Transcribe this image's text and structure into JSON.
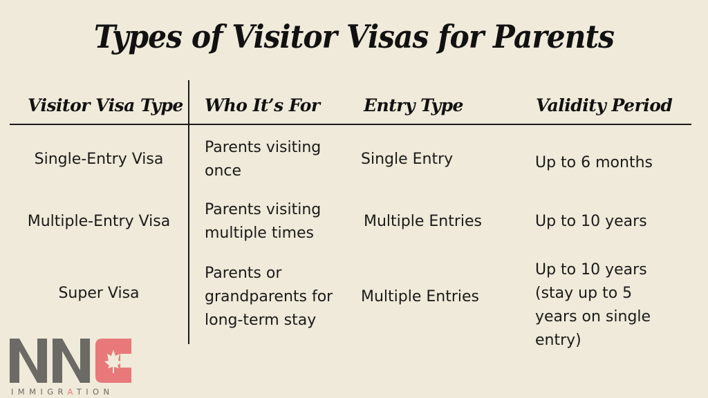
{
  "title": "Types of Visitor Visas for Parents",
  "table": {
    "headers": [
      "Visitor Visa Type",
      "Who It’s For",
      "Entry Type",
      "Validity Period"
    ],
    "rows": [
      {
        "type": "Single-Entry Visa",
        "who": [
          "Parents visiting",
          "once"
        ],
        "entry": "Single Entry",
        "validity": [
          "Up to 6 months"
        ]
      },
      {
        "type": "Multiple-Entry Visa",
        "who": [
          "Parents visiting",
          "multiple times"
        ],
        "entry": "Multiple Entries",
        "validity": [
          "Up to 10 years"
        ]
      },
      {
        "type": "Super Visa",
        "who": [
          "Parents or",
          "grandparents for",
          "long-term stay"
        ],
        "entry": "Multiple Entries",
        "validity": [
          "Up to 10 years",
          "(stay up to 5",
          "years on single",
          "entry)"
        ]
      }
    ]
  },
  "logo": {
    "letters": "NNC",
    "subtitle": "IMMIGRATION",
    "gray": "#6b6a64",
    "red": "#e8787a"
  }
}
